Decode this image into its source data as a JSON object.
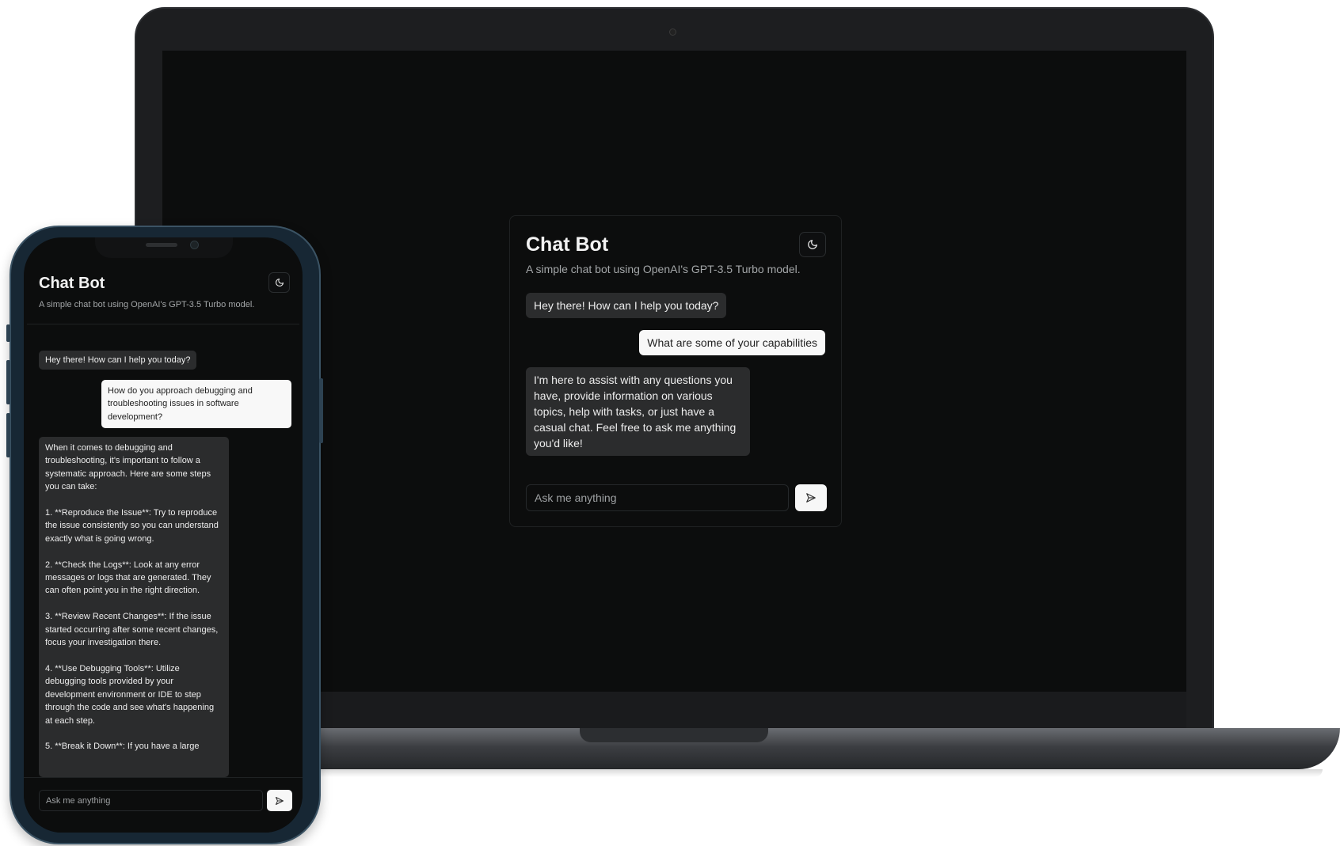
{
  "app": {
    "title": "Chat Bot",
    "subtitle": "A simple chat bot using OpenAI's GPT-3.5 Turbo model."
  },
  "laptop": {
    "messages": [
      {
        "role": "bot",
        "text": "Hey there! How can I help you today?"
      },
      {
        "role": "user",
        "text": "What are some of your capabilities"
      },
      {
        "role": "bot",
        "text": "I'm here to assist with any questions you have, provide information on various topics, help with tasks, or just have a casual chat. Feel free to ask me anything you'd like!"
      }
    ],
    "input": {
      "placeholder": "Ask me anything",
      "value": ""
    }
  },
  "phone": {
    "messages": [
      {
        "role": "bot",
        "text": "Hey there! How can I help you today?"
      },
      {
        "role": "user",
        "text": "How do you approach debugging and troubleshooting issues in software development?"
      },
      {
        "role": "bot",
        "text": "When it comes to debugging and troubleshooting, it's important to follow a systematic approach. Here are some steps you can take:\n\n1. **Reproduce the Issue**: Try to reproduce the issue consistently so you can understand exactly what is going wrong.\n\n2. **Check the Logs**: Look at any error messages or logs that are generated. They can often point you in the right direction.\n\n3. **Review Recent Changes**: If the issue started occurring after some recent changes, focus your investigation there.\n\n4. **Use Debugging Tools**: Utilize debugging tools provided by your development environment or IDE to step through the code and see what's happening at each step.\n\n5. **Break it Down**: If you have a large"
      }
    ],
    "input": {
      "placeholder": "Ask me anything",
      "value": ""
    }
  },
  "icons": {
    "theme_toggle": "moon-icon",
    "send": "send-icon"
  },
  "colors": {
    "background": "#0c0d0d",
    "bot_bubble": "#2b2c2d",
    "user_bubble": "#f8f8f8",
    "text": "#f2f2f2"
  }
}
